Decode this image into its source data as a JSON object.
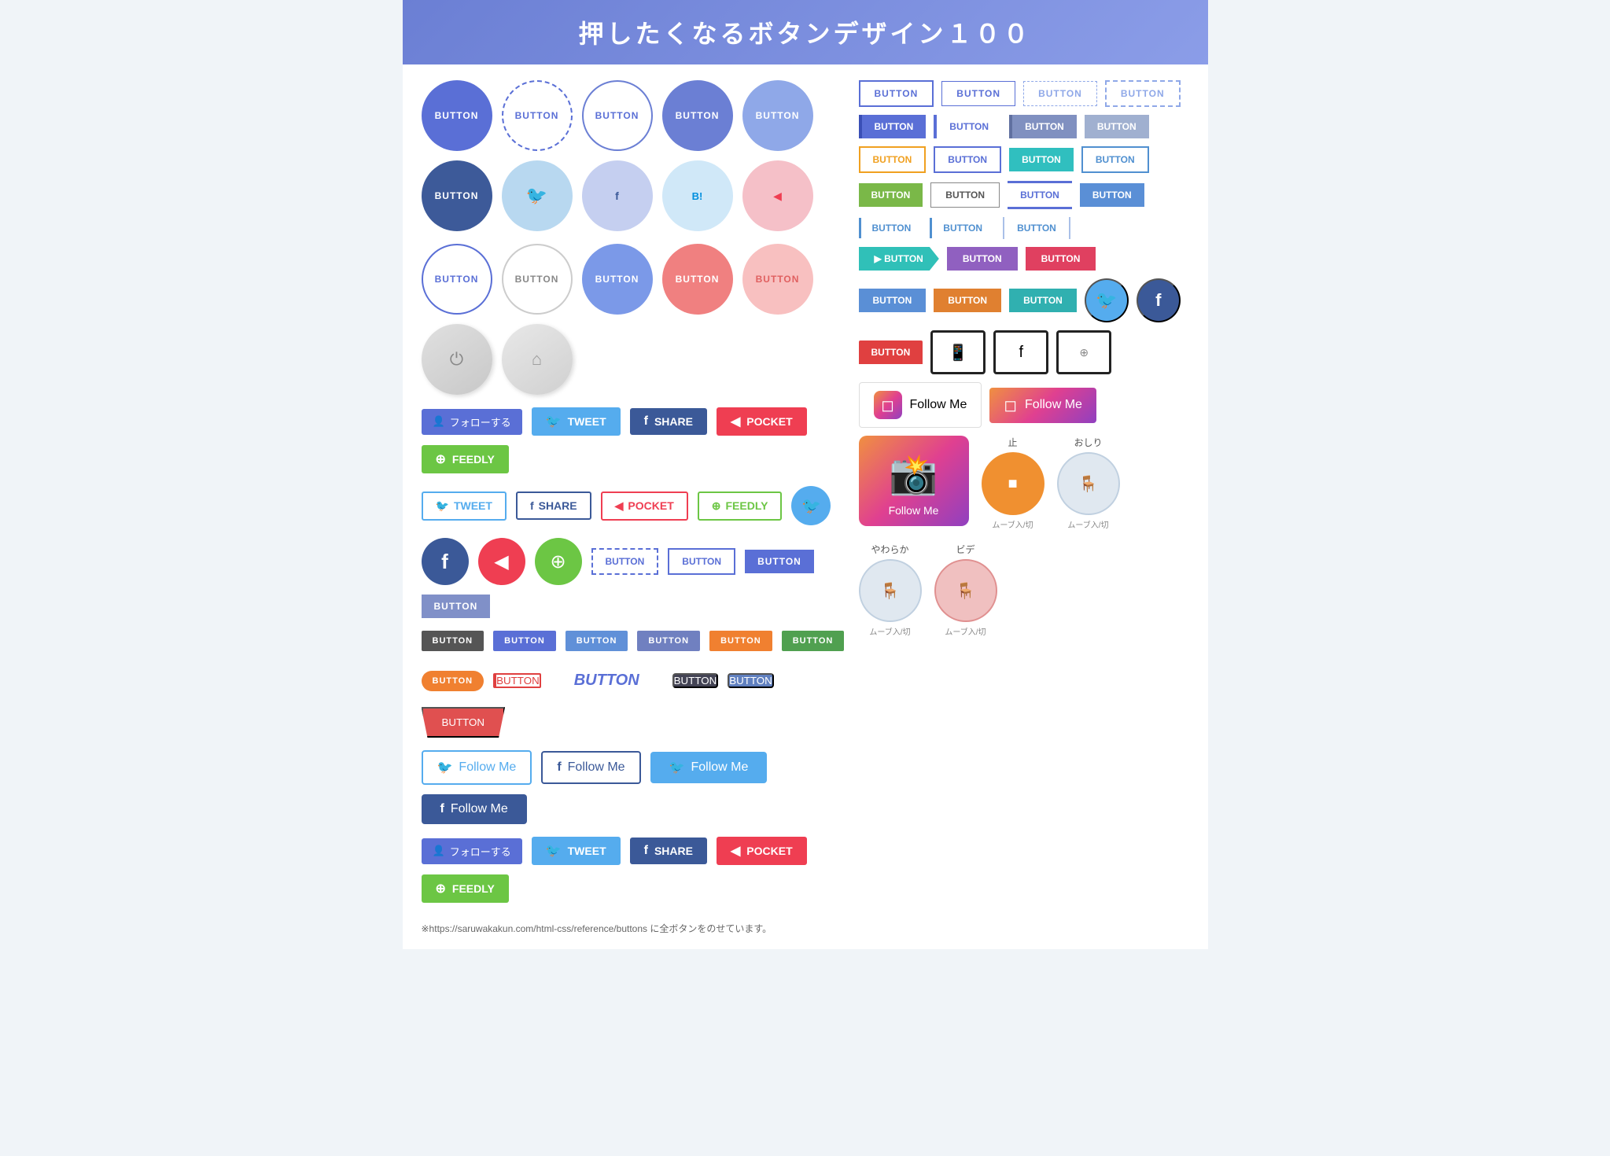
{
  "header": {
    "title": "押したくなるボタンデザイン１００"
  },
  "buttons": {
    "button_label": "BUTTON",
    "tweet": "TWEET",
    "share": "SHARE",
    "pocket": "POCKET",
    "feedly": "FEEDLY",
    "follow_me": "Follow Me",
    "follow_jp": "フォローする",
    "big_button": "BUTToN"
  },
  "footer": {
    "note": "※https://saruwakakun.com/html-css/reference/buttons に全ボタンをのせています。"
  },
  "right_section": {
    "ig_follow_text": "Follow Me",
    "ig_large_text": "Follow Me",
    "anim": {
      "stop": "止",
      "sit": "おしり",
      "soft": "やわらか",
      "video": "ビデ"
    }
  }
}
